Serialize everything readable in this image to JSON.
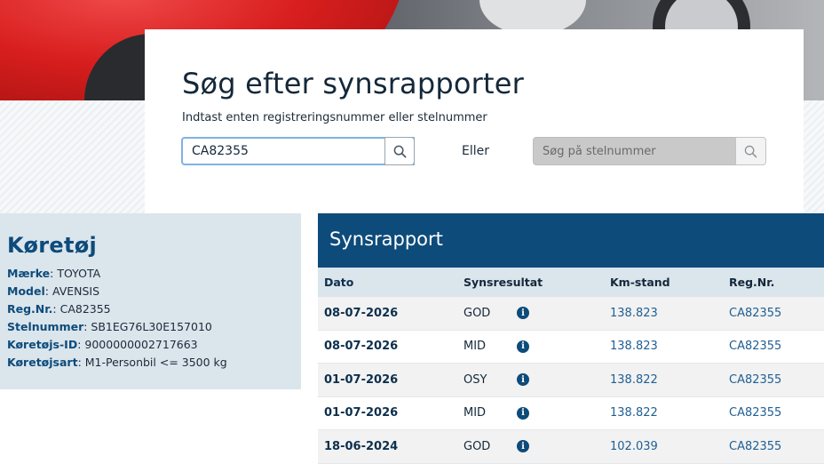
{
  "search": {
    "title": "Søg efter synsrapporter",
    "subtitle": "Indtast enten registreringsnummer eller stelnummer",
    "reg_value": "CA82355",
    "or_label": "Eller",
    "vin_placeholder": "Søg på stelnummer",
    "icon": "search-icon"
  },
  "vehicle": {
    "title": "Køretøj",
    "fields": [
      {
        "key": "Mærke",
        "value": "TOYOTA"
      },
      {
        "key": "Model",
        "value": "AVENSIS"
      },
      {
        "key": "Reg.Nr.",
        "value": "CA82355"
      },
      {
        "key": "Stelnummer",
        "value": "SB1EG76L30E157010"
      },
      {
        "key": "Køretøjs-ID",
        "value": "9000000002717663"
      },
      {
        "key": "Køretøjsart",
        "value": "M1-Personbil <= 3500 kg"
      }
    ]
  },
  "report": {
    "title": "Synsrapport",
    "columns": [
      "Dato",
      "Synsresultat",
      "Km-stand",
      "Reg.Nr."
    ],
    "info_glyph": "i",
    "rows": [
      {
        "date": "08-07-2026",
        "result": "GOD",
        "km": "138.823",
        "reg": "CA82355"
      },
      {
        "date": "08-07-2026",
        "result": "MID",
        "km": "138.823",
        "reg": "CA82355"
      },
      {
        "date": "01-07-2026",
        "result": "OSY",
        "km": "138.822",
        "reg": "CA82355"
      },
      {
        "date": "01-07-2026",
        "result": "MID",
        "km": "138.822",
        "reg": "CA82355"
      },
      {
        "date": "18-06-2024",
        "result": "GOD",
        "km": "102.039",
        "reg": "CA82355"
      }
    ]
  },
  "colors": {
    "brand": "#0d4b7a",
    "panel_bg": "#dbe5ec",
    "row_alt": "#f2f2f2"
  }
}
